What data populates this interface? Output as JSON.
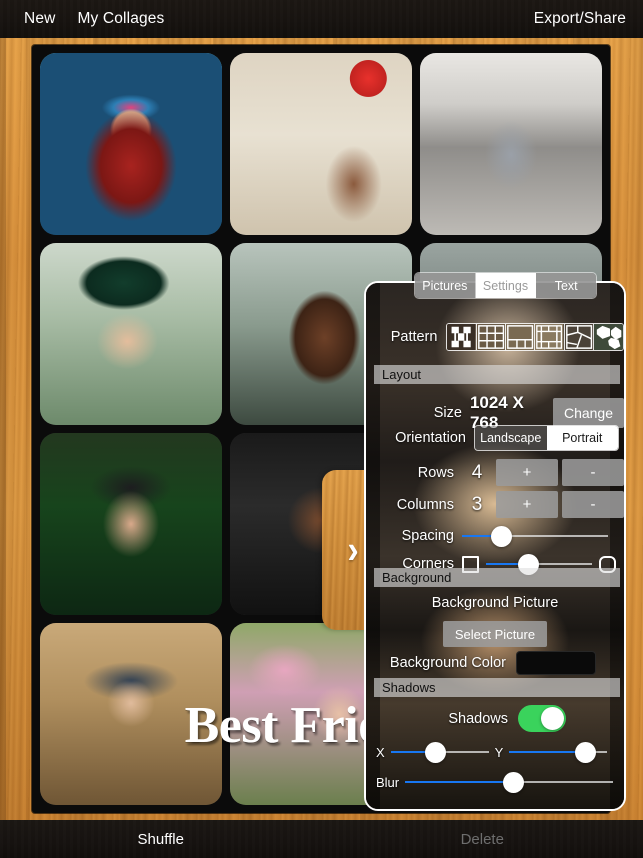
{
  "topbar": {
    "new_label": "New",
    "my_collages_label": "My Collages",
    "export_share_label": "Export/Share"
  },
  "collage": {
    "overlay_text": "Best Friends",
    "rows": 4,
    "columns": 3,
    "cell_count": 12
  },
  "panel_tab": {
    "chevron": "›"
  },
  "panel": {
    "tabs": [
      {
        "label": "Pictures",
        "selected": false
      },
      {
        "label": "Settings",
        "selected": true
      },
      {
        "label": "Text",
        "selected": false
      }
    ],
    "pattern": {
      "label": "Pattern",
      "options": [
        "pattern-blob",
        "pattern-grid-3x3",
        "pattern-hero-top",
        "pattern-mosaic",
        "pattern-diagonal",
        "pattern-hexagons"
      ],
      "selected_index": 0
    },
    "groups": {
      "layout": "Layout",
      "background": "Background",
      "shadows": "Shadows"
    },
    "size": {
      "label": "Size",
      "value": "1024 X 768",
      "change_label": "Change"
    },
    "orientation": {
      "label": "Orientation",
      "options": [
        "Landscape",
        "Portrait"
      ],
      "selected": "Portrait"
    },
    "rows": {
      "label": "Rows",
      "value": "4",
      "plus_label": "+",
      "minus_label": "-"
    },
    "columns": {
      "label": "Columns",
      "value": "3",
      "plus_label": "+",
      "minus_label": "-"
    },
    "spacing": {
      "label": "Spacing",
      "percent": 27
    },
    "corners": {
      "label": "Corners",
      "percent": 40,
      "left_icon": "square-icon",
      "right_icon": "rounded-square-icon"
    },
    "background": {
      "picture_label": "Background Picture",
      "select_picture_label": "Select Picture",
      "color_label": "Background Color",
      "color_value": "#0a0a0a"
    },
    "shadows": {
      "toggle_label": "Shadows",
      "enabled": true,
      "x": {
        "label": "X",
        "percent": 46
      },
      "y": {
        "label": "Y",
        "percent": 78
      },
      "blur": {
        "label": "Blur",
        "percent": 52
      }
    }
  },
  "bottombar": {
    "shuffle_label": "Shuffle",
    "delete_label": "Delete"
  },
  "colors": {
    "accent_blue": "#1877f2",
    "toggle_green": "#3ad35c",
    "wood": "#d9913c",
    "board": "#0b0b0b"
  }
}
